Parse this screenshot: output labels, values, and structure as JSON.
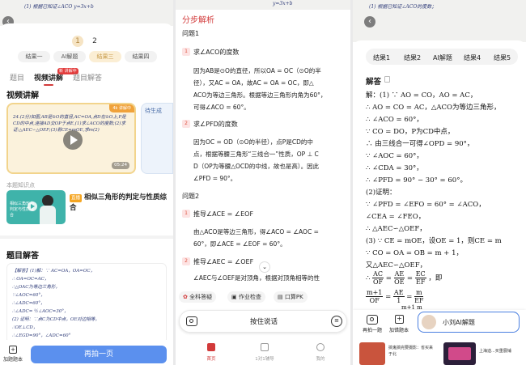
{
  "panel_left": {
    "page_indicator": {
      "current": "1",
      "next": "2"
    },
    "result_chips": [
      "结果一",
      "AI解题",
      "结果三",
      "结果四"
    ],
    "tabs": {
      "items": [
        "题目",
        "视频讲解",
        "题目解答"
      ],
      "new_badge": "新 讲解中"
    },
    "video_section_title": "视频讲解",
    "video_badge": "4k 讲解中",
    "video_duration": "05:24",
    "side_card_label": "待生成",
    "knowledge_note": "本题知识点",
    "lesson_badge": "直播",
    "lesson_title": "相似三角形的判定与性质综合",
    "lesson_thumb_text": "相似三角形的判定与性质综合",
    "answer_section_title": "题目解答",
    "answer_lines": [
      "【解答】(1)解：∵ AC=OA，OA=OC，",
      "∴ OA=OC=AC，",
      "∴△OAC为等边三角形，",
      "∵∠AOC=60°，",
      "∴∠ADC=60°，",
      "∴∠ADC= ½∠AOC=30°，",
      "(2) 证明：∵点C为CD中点，OE对边相等，",
      "∴OE⊥CD，",
      "∴∠EGD=90°，∠ADC=60°"
    ],
    "add_button": "加题题本",
    "retake_button": "再拍一页",
    "top_paper_text": "(1) 根据已知证∠ACO  y=3x+b"
  },
  "panel_middle": {
    "title": "分步解析",
    "q1": "问题1",
    "s1_head": "求∠ACO的度数",
    "s1_body": [
      "因为AB是⊙O的直径，所以OA = OC（⊙O的半",
      "径），又AC = OA，故AC = OA = OC，即△",
      "ACO为等边三角形。根据等边三角形内角为60°，",
      "可得∠ACO = 60°。"
    ],
    "s2_head": "求∠PFD的度数",
    "s2_body": [
      "因为OC = OD（⊙O的半径），点P是CD的中",
      "点，根据等腰三角形“三线合一”性质，OP ⊥ C",
      "D（OP为等腰△OCD的中线，故也是高）。因此",
      "∠PFD = 90°。"
    ],
    "q2": "问题2",
    "s3_head": "推导∠ACE = ∠EOF",
    "s3_body": [
      "由△ACO是等边三角形，得∠ACO = ∠AOC =",
      "60°，即∠ACE = ∠EOF = 60°。"
    ],
    "s4_head": "推导∠AEC = ∠OEF",
    "s4_body": [
      "∠AEC与∠OEF是对顶角，根据对顶角相等的性"
    ],
    "chips": [
      "全科答疑",
      "作业检查",
      "口算PK"
    ],
    "input_placeholder": "按住说话",
    "nav": [
      "首页",
      "1对1辅导",
      "我的"
    ],
    "top_paper_text": "y=3x+b"
  },
  "panel_right": {
    "tabs": [
      "结果1",
      "结果2",
      "AI解题",
      "结果4",
      "结果5"
    ],
    "answer_title": "解答",
    "lines": [
      "解：(1) ∵ AO = CO，AO = AC，",
      "∴ AO = CO = AC，△ACO为等边三角形，",
      "∴ ∠ACO = 60°，",
      "∵ CO = DO，P为CD中点，",
      "∴ 由三线合一可得∠OPD = 90°，",
      "∵ ∠AOC = 60°，",
      "∴ ∠CDA = 30°，",
      "∴ ∠PFD = 90° − 30° = 60°。",
      "(2)证明：",
      "∵ ∠PFD = ∠EFO = 60° = ∠ACO，",
      "∠CEA = ∠FEO，",
      "∴ △AEC∽△OEF，",
      "(3) ∵ CE = mOE，设OE = 1，则CE = m",
      "∵ CO = OA = OB = m + 1，",
      "又△AEC∽△OEF，"
    ],
    "frac_line": {
      "prefix": "∴",
      "a_num": "AC",
      "a_den": "OF",
      "b_num": "AE",
      "b_den": "OE",
      "c_num": "EC",
      "c_den": "EF",
      "suffix": "，即"
    },
    "frac_line2": {
      "a_num": "m+1",
      "a_den": "OF",
      "b_num": "AE",
      "b_den": "1",
      "c_num": "m",
      "c_den": "EF"
    },
    "tail_text": "m+1        m",
    "tools": [
      "再拍一题",
      "加错题本"
    ],
    "ai_button": "小刘AI解题",
    "ads": [
      "搞鬼搞完要摄影：省买来于北",
      "上海迪...买重展铺"
    ],
    "top_paper_text": "(1) 根据已知证∠ACO的度数；"
  }
}
